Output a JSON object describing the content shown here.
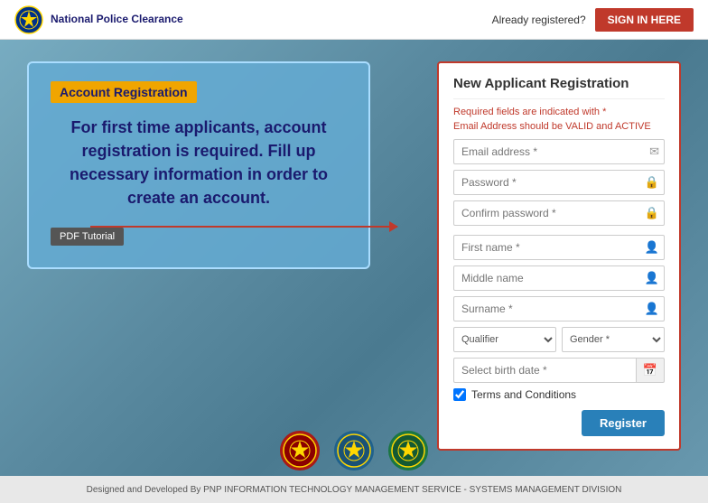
{
  "navbar": {
    "brand_name": "National Police\nClearance",
    "already_registered_label": "Already registered?",
    "sign_in_label": "SIGN IN HERE"
  },
  "left_panel": {
    "badge_label": "Account Registration",
    "description": "For first time applicants, account registration is required. Fill up necessary information in order to create an account.",
    "pdf_tutorial_label": "PDF Tutorial"
  },
  "form": {
    "title": "New Applicant Registration",
    "required_note": "Required fields are indicated with",
    "required_star": "*",
    "email_note": "Email Address should be VALID and ACTIVE",
    "email_placeholder": "Email address *",
    "password_placeholder": "Password *",
    "confirm_password_placeholder": "Confirm password *",
    "first_name_placeholder": "First name *",
    "middle_name_placeholder": "Middle name",
    "surname_placeholder": "Surname *",
    "qualifier_placeholder": "Qualifier",
    "gender_placeholder": "Gender *",
    "birthdate_placeholder": "Select birth date *",
    "terms_label": "Terms and Conditions",
    "register_label": "Register"
  },
  "footer": {
    "text": "Designed and Developed By PNP INFORMATION TECHNOLOGY MANAGEMENT SERVICE - SYSTEMS MANAGEMENT DIVISION"
  },
  "icons": {
    "email": "✉",
    "lock": "🔒",
    "person": "👤",
    "calendar": "📅"
  }
}
